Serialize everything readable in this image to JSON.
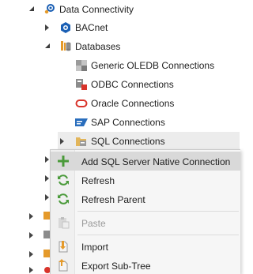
{
  "tree": {
    "data_connectivity": {
      "label": "Data Connectivity",
      "icon": "gear-plug-icon"
    },
    "bacnet": {
      "label": "BACnet",
      "icon": "bacnet-icon"
    },
    "databases": {
      "label": "Databases",
      "icon": "database-folder-icon"
    },
    "items": [
      {
        "label": "Generic OLEDB Connections",
        "icon": "oledb-icon"
      },
      {
        "label": "ODBC Connections",
        "icon": "odbc-icon"
      },
      {
        "label": "Oracle Connections",
        "icon": "oracle-icon"
      },
      {
        "label": "SAP Connections",
        "icon": "sap-icon"
      },
      {
        "label": "SQL Connections",
        "icon": "sql-folder-icon"
      }
    ]
  },
  "context_menu": {
    "items": [
      {
        "label": "Add SQL Server Native Connection",
        "icon": "plus-icon",
        "highlighted": true
      },
      {
        "label": "Refresh",
        "icon": "refresh-icon"
      },
      {
        "label": "Refresh Parent",
        "icon": "refresh-icon"
      },
      {
        "label": "Paste",
        "icon": "paste-icon",
        "disabled": true
      },
      {
        "label": "Import",
        "icon": "import-icon"
      },
      {
        "label": "Export Sub-Tree",
        "icon": "export-icon"
      }
    ]
  },
  "colors": {
    "accent_blue": "#1a5fb4",
    "highlight": "#d9d9d9",
    "plus_green": "#4a9a3a",
    "oracle_red": "#d9342b"
  }
}
